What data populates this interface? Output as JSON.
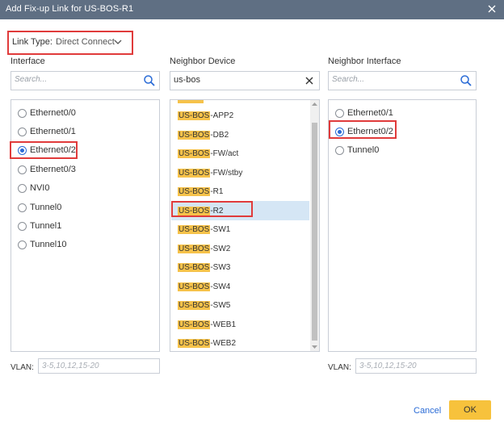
{
  "dialog": {
    "title": "Add Fix-up Link for US-BOS-R1"
  },
  "link_type": {
    "label": "Link Type:",
    "value": "Direct Connect"
  },
  "interface": {
    "title": "Interface",
    "search_placeholder": "Search...",
    "items": [
      "Ethernet0/0",
      "Ethernet0/1",
      "Ethernet0/2",
      "Ethernet0/3",
      "NVI0",
      "Tunnel0",
      "Tunnel1",
      "Tunnel10"
    ],
    "selected": "Ethernet0/2"
  },
  "neighbor_device": {
    "title": "Neighbor Device",
    "search_value": "us-bos",
    "highlight_text": "US-BOS",
    "items": [
      {
        "hl": "US-BOS",
        "rest": "-APP2"
      },
      {
        "hl": "US-BOS",
        "rest": "-DB2"
      },
      {
        "hl": "US-BOS",
        "rest": "-FW/act"
      },
      {
        "hl": "US-BOS",
        "rest": "-FW/stby"
      },
      {
        "hl": "US-BOS",
        "rest": "-R1"
      },
      {
        "hl": "US-BOS",
        "rest": "-R2"
      },
      {
        "hl": "US-BOS",
        "rest": "-SW1"
      },
      {
        "hl": "US-BOS",
        "rest": "-SW2"
      },
      {
        "hl": "US-BOS",
        "rest": "-SW3"
      },
      {
        "hl": "US-BOS",
        "rest": "-SW4"
      },
      {
        "hl": "US-BOS",
        "rest": "-SW5"
      },
      {
        "hl": "US-BOS",
        "rest": "-WEB1"
      },
      {
        "hl": "US-BOS",
        "rest": "-WEB2"
      }
    ],
    "selected": "US-BOS-R2"
  },
  "neighbor_interface": {
    "title": "Neighbor Interface",
    "search_placeholder": "Search...",
    "items": [
      "Ethernet0/1",
      "Ethernet0/2",
      "Tunnel0"
    ],
    "selected": "Ethernet0/2"
  },
  "vlan": {
    "label": "VLAN:",
    "placeholder": "3-5,10,12,15-20"
  },
  "buttons": {
    "cancel": "Cancel",
    "ok": "OK"
  },
  "colors": {
    "titlebar": "#5f6f83",
    "accent": "#2a6bd6",
    "highlight": "#f6c24a",
    "ok_button": "#f7c23c",
    "annotation_box": "#e03b3b"
  }
}
